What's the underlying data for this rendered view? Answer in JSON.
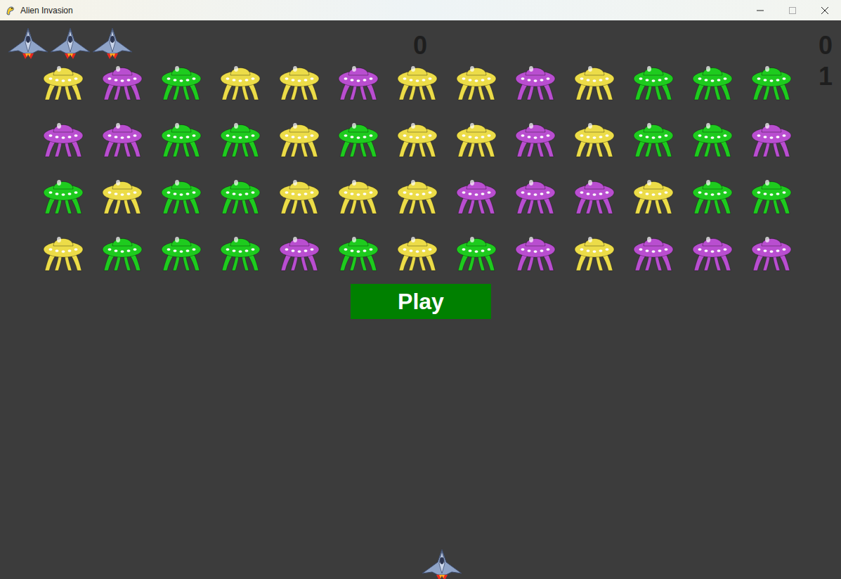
{
  "window": {
    "title": "Alien Invasion"
  },
  "scoreboard": {
    "score": "0",
    "high_score": "0",
    "level": "1"
  },
  "lives": 3,
  "fleet": [
    [
      {
        "color": "#ecdc48"
      },
      {
        "color": "#b94ed0"
      },
      {
        "color": "#1ecb1e"
      },
      {
        "color": "#ecdc48"
      },
      {
        "color": "#ecdc48"
      },
      {
        "color": "#b94ed0"
      },
      {
        "color": "#ecdc48"
      },
      {
        "color": "#ecdc48"
      },
      {
        "color": "#b94ed0"
      },
      {
        "color": "#ecdc48"
      },
      {
        "color": "#1ecb1e"
      },
      {
        "color": "#1ecb1e"
      },
      {
        "color": "#1ecb1e"
      }
    ],
    [
      {
        "color": "#b94ed0"
      },
      {
        "color": "#b94ed0"
      },
      {
        "color": "#1ecb1e"
      },
      {
        "color": "#1ecb1e"
      },
      {
        "color": "#ecdc48"
      },
      {
        "color": "#1ecb1e"
      },
      {
        "color": "#ecdc48"
      },
      {
        "color": "#ecdc48"
      },
      {
        "color": "#b94ed0"
      },
      {
        "color": "#ecdc48"
      },
      {
        "color": "#1ecb1e"
      },
      {
        "color": "#1ecb1e"
      },
      {
        "color": "#b94ed0"
      }
    ],
    [
      {
        "color": "#1ecb1e"
      },
      {
        "color": "#ecdc48"
      },
      {
        "color": "#1ecb1e"
      },
      {
        "color": "#1ecb1e"
      },
      {
        "color": "#ecdc48"
      },
      {
        "color": "#ecdc48"
      },
      {
        "color": "#ecdc48"
      },
      {
        "color": "#b94ed0"
      },
      {
        "color": "#b94ed0"
      },
      {
        "color": "#b94ed0"
      },
      {
        "color": "#ecdc48"
      },
      {
        "color": "#1ecb1e"
      },
      {
        "color": "#1ecb1e"
      }
    ],
    [
      {
        "color": "#ecdc48"
      },
      {
        "color": "#1ecb1e"
      },
      {
        "color": "#1ecb1e"
      },
      {
        "color": "#1ecb1e"
      },
      {
        "color": "#b94ed0"
      },
      {
        "color": "#1ecb1e"
      },
      {
        "color": "#ecdc48"
      },
      {
        "color": "#1ecb1e"
      },
      {
        "color": "#b94ed0"
      },
      {
        "color": "#ecdc48"
      },
      {
        "color": "#b94ed0"
      },
      {
        "color": "#b94ed0"
      },
      {
        "color": "#b94ed0"
      }
    ]
  ],
  "play_button": {
    "label": "Play"
  }
}
